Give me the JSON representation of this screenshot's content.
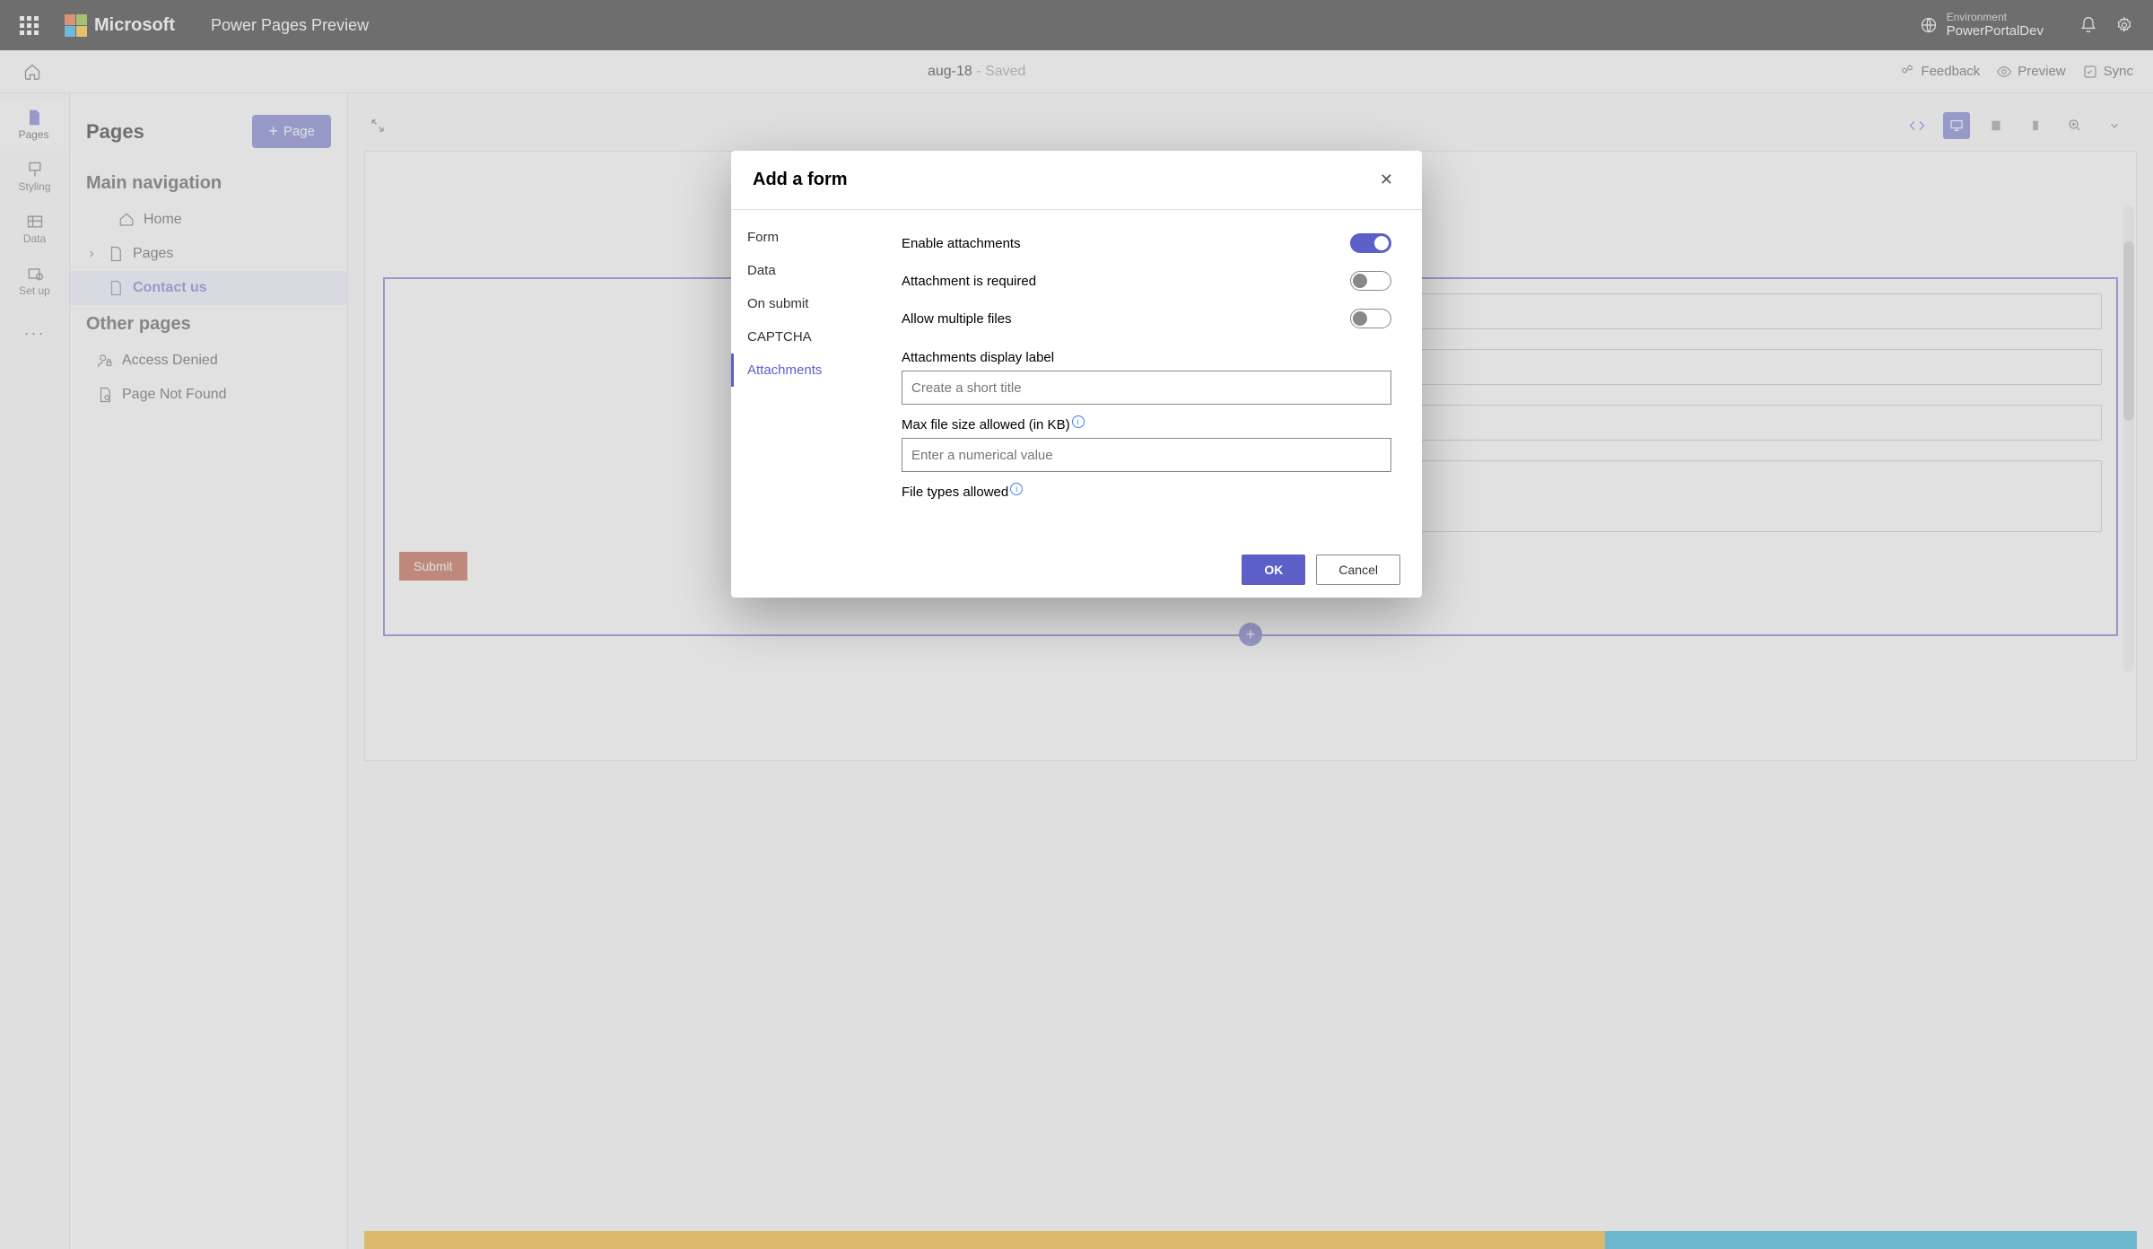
{
  "header": {
    "brand": "Microsoft",
    "product": "Power Pages Preview",
    "env_label": "Environment",
    "env_name": "PowerPortalDev"
  },
  "subheader": {
    "page_name": "aug-18",
    "status": " - Saved",
    "actions": {
      "feedback": "Feedback",
      "preview": "Preview",
      "sync": "Sync"
    }
  },
  "rail": {
    "pages": "Pages",
    "styling": "Styling",
    "data": "Data",
    "setup": "Set up"
  },
  "side": {
    "title": "Pages",
    "add_page": "Page",
    "nav_title": "Main navigation",
    "items": {
      "home": "Home",
      "pages": "Pages",
      "contact": "Contact us"
    },
    "other_title": "Other pages",
    "other_items": {
      "denied": "Access Denied",
      "notfound": "Page Not Found"
    }
  },
  "form_canvas": {
    "submit": "Submit"
  },
  "modal": {
    "title": "Add a form",
    "nav": {
      "form": "Form",
      "data": "Data",
      "onsubmit": "On submit",
      "captcha": "CAPTCHA",
      "attachments": "Attachments"
    },
    "settings": {
      "enable_attachments": "Enable attachments",
      "attachment_required": "Attachment is required",
      "allow_multiple": "Allow multiple files",
      "display_label": "Attachments display label",
      "display_placeholder": "Create a short title",
      "max_size": "Max file size allowed (in KB)",
      "max_size_placeholder": "Enter a numerical value",
      "file_types": "File types allowed"
    },
    "footer": {
      "ok": "OK",
      "cancel": "Cancel"
    }
  }
}
